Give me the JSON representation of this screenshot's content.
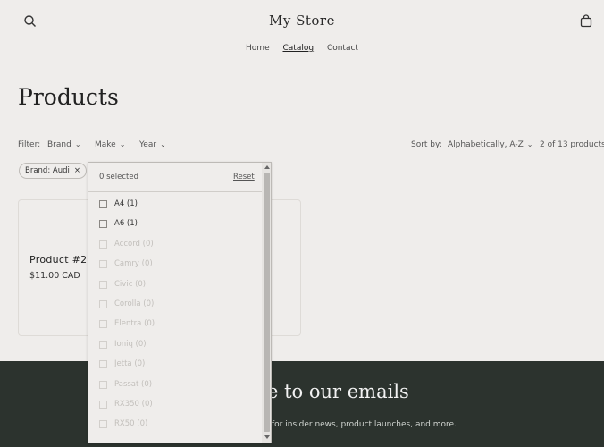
{
  "header": {
    "store_name": "My Store",
    "search_icon": "search-icon",
    "cart_icon": "cart-icon",
    "nav": [
      {
        "label": "Home",
        "active": false
      },
      {
        "label": "Catalog",
        "active": true
      },
      {
        "label": "Contact",
        "active": false
      }
    ]
  },
  "page": {
    "title": "Products"
  },
  "filters": {
    "label": "Filter:",
    "brand": "Brand",
    "make": "Make",
    "year": "Year",
    "sort_label": "Sort by:",
    "sort_value": "Alphabetically, A-Z",
    "count": "2 of 13 products",
    "active_chip": "Brand: Audi",
    "chip_remove": "×"
  },
  "dropdown": {
    "selected": "0 selected",
    "reset": "Reset",
    "options": [
      {
        "label": "A4 (1)",
        "enabled": true
      },
      {
        "label": "A6 (1)",
        "enabled": true
      },
      {
        "label": "Accord (0)",
        "enabled": false
      },
      {
        "label": "Camry (0)",
        "enabled": false
      },
      {
        "label": "Civic (0)",
        "enabled": false
      },
      {
        "label": "Corolla (0)",
        "enabled": false
      },
      {
        "label": "Elentra (0)",
        "enabled": false
      },
      {
        "label": "Ioniq (0)",
        "enabled": false
      },
      {
        "label": "Jetta (0)",
        "enabled": false
      },
      {
        "label": "Passat (0)",
        "enabled": false
      },
      {
        "label": "RX350 (0)",
        "enabled": false
      },
      {
        "label": "RX50 (0)",
        "enabled": false
      }
    ]
  },
  "products": [
    {
      "name": "Product #2",
      "price": "$11.00 CAD"
    }
  ],
  "footer": {
    "title": "e to our emails",
    "subtitle": "for insider news, product launches, and more."
  },
  "colors": {
    "background": "#efedeb",
    "footer_bg": "#2c332e",
    "text": "#333333"
  }
}
